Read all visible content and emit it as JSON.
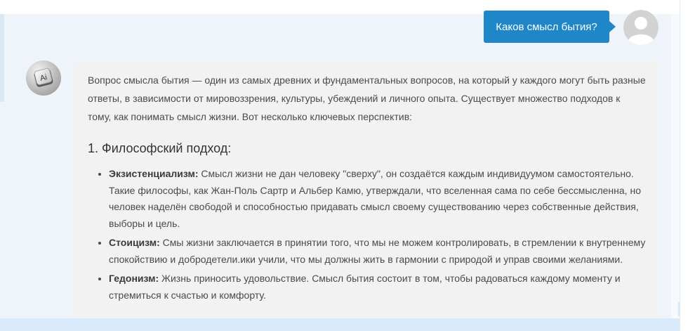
{
  "chat": {
    "user_message": "Каков смысл бытия?",
    "ai_avatar_text": "Ai",
    "ai_response": {
      "intro": "Вопрос смысла бытия — один из самых древних и фундаментальных вопросов, на который у каждого могут быть разные ответы, в зависимости от мировоззрения, культуры, убеждений и личного опыта. Существует множество подходов к тому, как понимать смысл жизни. Вот несколько ключевых перспектив:",
      "section_heading": "1. Философский подход:",
      "items": [
        {
          "term": "Экзистенциализм:",
          "text": " Смысл жизни не дан человеку \"сверху\", он создаётся каждым индивидуумом самостоятельно. Такие философы, как Жан-Поль Сартр и Альбер Камю, утверждали, что вселенная сама по себе бессмысленна, но человек наделён свободой и способностью придавать смысл своему существованию через собственные действия, выборы и цель."
        },
        {
          "term": "Стоицизм:",
          "text": " Смы жизни заключается в принятии того, что мы не можем контролировать, в стремлении к внутреннему спокойствию и добродетели.ики учили, что мы должны жить в гармонии с природой и управ своими желаниями."
        },
        {
          "term": "Гедонизм:",
          "text": " Жизнь приносить удовольствие. Смысл бытия состоит в том, чтобы радоваться каждому моменту и стремиться к счастью и комфорту."
        }
      ]
    }
  },
  "colors": {
    "user_bubble": "#1f87c8",
    "ai_bubble": "#f2f2f2",
    "background": "#eef4fa"
  }
}
